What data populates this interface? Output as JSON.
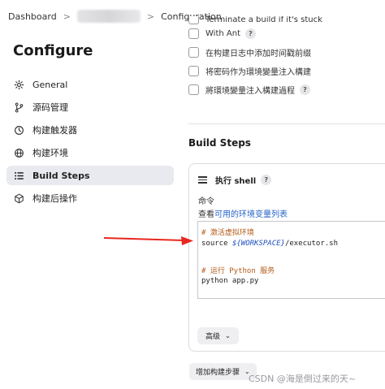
{
  "breadcrumb": {
    "dashboard": "Dashboard",
    "separator": ">",
    "current": "Configuration"
  },
  "page": {
    "title": "Configure"
  },
  "nav": {
    "items": [
      {
        "label": "General",
        "icon": "gear-icon"
      },
      {
        "label": "源码管理",
        "icon": "branch-icon"
      },
      {
        "label": "构建触发器",
        "icon": "clock-icon"
      },
      {
        "label": "构建环境",
        "icon": "globe-icon"
      },
      {
        "label": "Build Steps",
        "icon": "list-icon",
        "active": true
      },
      {
        "label": "构建后操作",
        "icon": "cube-icon"
      }
    ]
  },
  "options": {
    "clipped": "Terminate a build if it's stuck",
    "items": [
      {
        "label": "With Ant",
        "help": "?"
      },
      {
        "label": "在构建日志中添加时间戳前缀",
        "help": ""
      },
      {
        "label": "将密码作为環境變量注入構建",
        "help": ""
      },
      {
        "label": "將環境變量注入構建過程",
        "help": "?"
      }
    ]
  },
  "build_steps": {
    "title": "Build Steps",
    "step_title": "执行 shell",
    "step_help": "?",
    "command_label": "命令",
    "env_prefix": "查看",
    "env_link": "可用的环境变量列表",
    "code": {
      "line1": "# 激活虚拟环境",
      "line2_a": "source ",
      "line2_var": "${WORKSPACE}",
      "line2_b": "/executor.sh",
      "line3": "# 运行 Python 服务",
      "line4": "python app.py"
    },
    "advanced_label": "高级",
    "add_step_label": "增加构建步骤"
  },
  "annotation": {
    "arrow_color": "#e8271f"
  },
  "watermark": "CSDN @海是倒过来的天~",
  "colors": {
    "link": "#2563c9",
    "active_bg": "#e9eaef",
    "comment": "#b35a1a"
  }
}
